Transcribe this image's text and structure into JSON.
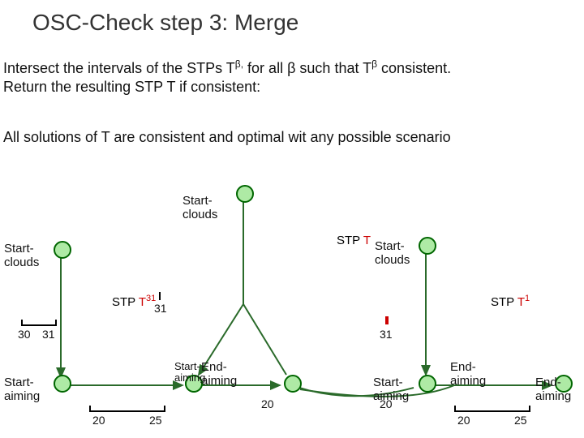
{
  "title": "OSC-Check step 3: Merge",
  "para1_a": "Intersect the intervals of the STPs T",
  "para1_b": "β,",
  "para1_c": " for all β such that T",
  "para1_d": "β",
  "para1_e": " consistent.",
  "para1_line2": "Return the resulting STP T if consistent:",
  "para2": "All solutions of T are consistent and optimal wit any possible scenario",
  "labels": {
    "start_clouds": "Start-\nclouds",
    "start_aiming": "Start-\naiming",
    "end_aiming": "End-\naiming"
  },
  "stp": {
    "plain": "STP ",
    "T": "T",
    "T31": "T",
    "T31_exp": "31",
    "T1_exp": "1"
  },
  "nums": {
    "n30": "30",
    "n31": "31",
    "n20": "20",
    "n25": "25"
  },
  "chart_data": {
    "type": "diagram",
    "title": "OSC-Check step 3: Merge",
    "description": "Three STP diagrams (T31, T, T1) each with nodes Start-clouds, Start-aiming, End-aiming and interval-labelled edges.",
    "graphs": [
      {
        "name": "STP T31",
        "nodes": [
          "Start-clouds",
          "Start-aiming",
          "End-aiming"
        ],
        "edges": [
          {
            "from": "Start-clouds",
            "to": "Start-aiming",
            "interval": [
              30,
              31
            ]
          },
          {
            "from": "Start-aiming",
            "to": "End-aiming",
            "interval": [
              20,
              25
            ]
          }
        ]
      },
      {
        "name": "STP T",
        "nodes": [
          "Start-clouds",
          "Start-aiming",
          "End-aiming"
        ],
        "edges": [
          {
            "from": "Start-clouds",
            "to": "Start-aiming",
            "interval": [
              31,
              31
            ]
          },
          {
            "from": "Start-aiming",
            "to": "End-aiming",
            "interval": [
              20,
              20
            ]
          }
        ]
      },
      {
        "name": "STP T1",
        "nodes": [
          "Start-clouds",
          "Start-aiming",
          "End-aiming"
        ],
        "edges": [
          {
            "from": "Start-clouds",
            "to": "Start-aiming",
            "interval": [
              31,
              null
            ]
          },
          {
            "from": "Start-aiming",
            "to": "End-aiming",
            "interval": [
              20,
              25
            ]
          }
        ]
      }
    ]
  }
}
